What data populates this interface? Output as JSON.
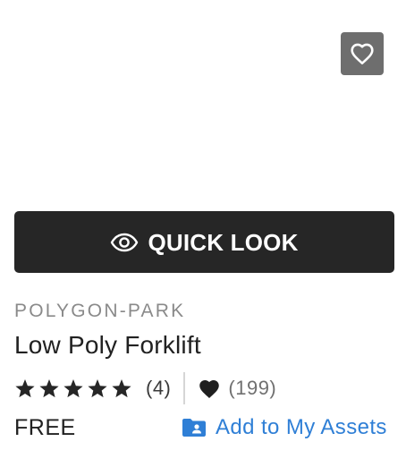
{
  "product": {
    "publisher": "POLYGON-PARK",
    "title": "Low Poly Forklift",
    "rating": {
      "stars": 5,
      "count_label": "(4)"
    },
    "favorites": {
      "count_label": "(199)"
    },
    "price": "FREE"
  },
  "actions": {
    "quick_look_label": "QUICK LOOK",
    "add_to_assets_label": "Add to My Assets"
  },
  "icons": {
    "wishlist": "heart-outline-icon",
    "quick_look": "eye-icon",
    "star": "star-icon",
    "favorite": "heart-filled-icon",
    "add_to_assets": "folder-person-icon"
  },
  "colors": {
    "quick_look_bg": "#262626",
    "wishlist_bg": "#6e6e6e",
    "link": "#2f7fd6",
    "publisher": "#8a8a8a",
    "text": "#212121"
  }
}
